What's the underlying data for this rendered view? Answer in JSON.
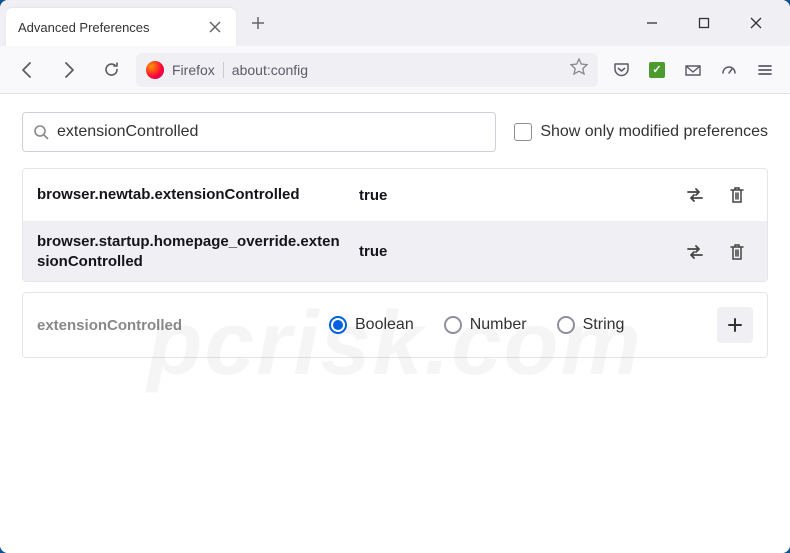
{
  "tab": {
    "title": "Advanced Preferences"
  },
  "urlbar": {
    "identity": "Firefox",
    "url": "about:config"
  },
  "search": {
    "value": "extensionControlled",
    "modified_label": "Show only modified preferences"
  },
  "prefs": [
    {
      "name": "browser.newtab.extensionControlled",
      "value": "true"
    },
    {
      "name": "browser.startup.homepage_override.extensionControlled",
      "value": "true"
    }
  ],
  "add": {
    "name": "extensionControlled",
    "types": [
      "Boolean",
      "Number",
      "String"
    ],
    "selected": "Boolean"
  },
  "watermark": "pcrisk.com"
}
